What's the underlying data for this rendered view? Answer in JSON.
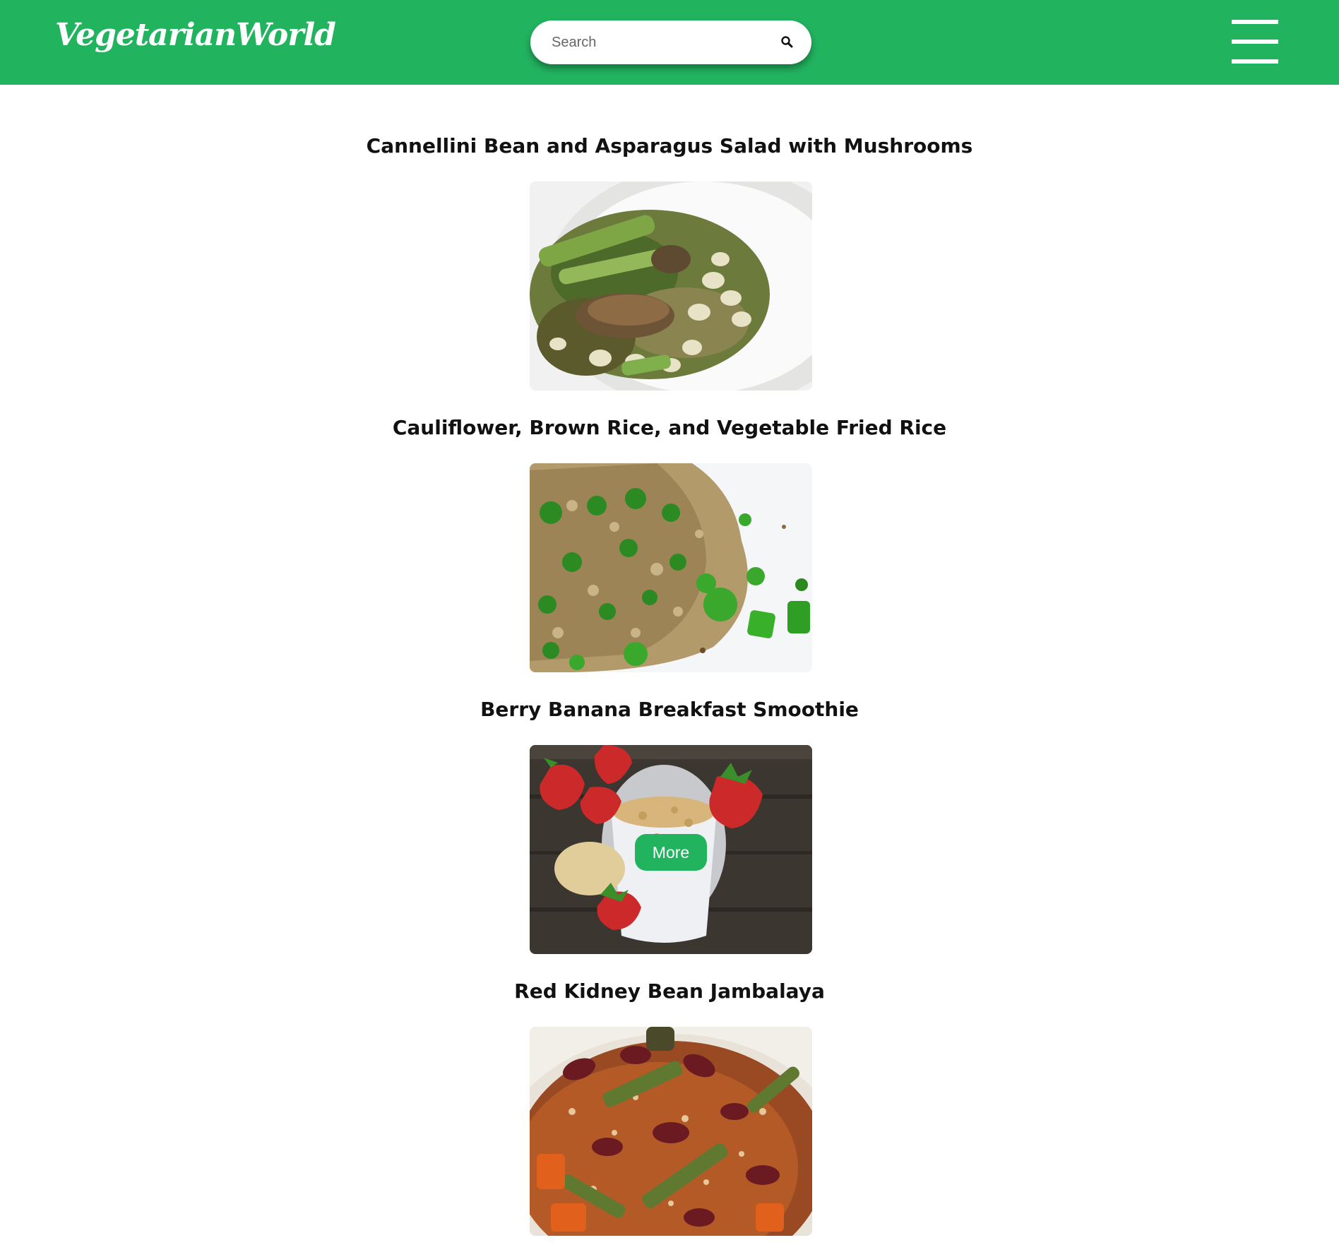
{
  "header": {
    "logo": "VegetarianWorld",
    "search": {
      "placeholder": "Search"
    },
    "brand_color": "#22b35f"
  },
  "recipes": [
    {
      "title": "Cannellini Bean and Asparagus Salad with Mushrooms"
    },
    {
      "title": "Cauliflower, Brown Rice, and Vegetable Fried Rice"
    },
    {
      "title": "Berry Banana Breakfast Smoothie",
      "more_label": "More"
    },
    {
      "title": "Red Kidney Bean Jambalaya"
    }
  ]
}
